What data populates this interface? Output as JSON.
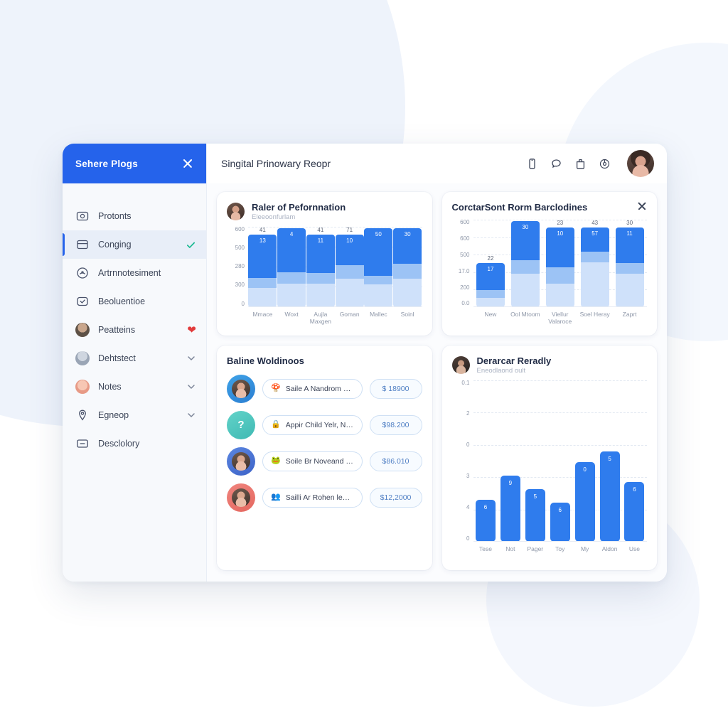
{
  "sidebar": {
    "title": "Sehere Plogs",
    "items": [
      {
        "label": "Protonts",
        "icon": "camera-icon",
        "trailing": "none"
      },
      {
        "label": "Conging",
        "icon": "window-icon",
        "trailing": "check"
      },
      {
        "label": "Artrnnotesiment",
        "icon": "compass-icon",
        "trailing": "none"
      },
      {
        "label": "Beoluentioe",
        "icon": "check-box-icon",
        "trailing": "none"
      },
      {
        "label": "Peatteins",
        "icon": "avatar-icon",
        "trailing": "heart"
      },
      {
        "label": "Dehtstect",
        "icon": "avatar-icon",
        "trailing": "chevron"
      },
      {
        "label": "Notes",
        "icon": "avatar-icon",
        "trailing": "chevron"
      },
      {
        "label": "Egneop",
        "icon": "pin-icon",
        "trailing": "chevron"
      },
      {
        "label": "Desclolory",
        "icon": "card-icon",
        "trailing": "none"
      }
    ]
  },
  "topbar": {
    "title": "Singital Prinowary Reopr",
    "icons": [
      "phone-icon",
      "chat-icon",
      "bag-icon",
      "globe-icon"
    ]
  },
  "cards": {
    "performance": {
      "title": "Raler of Pefornnation",
      "subtitle": "Eleeoonfurlam"
    },
    "breakdown": {
      "title": "CorctarSont Rorm Barclodines"
    },
    "list": {
      "title": "Baline Woldinoos"
    },
    "ready": {
      "title": "Derarcar Reradly",
      "subtitle": "Eneodlaond oult"
    }
  },
  "list_rows": [
    {
      "emoji": "🍄",
      "text": "Saile A Nandrom Clnins",
      "amount": "$ 18900",
      "avatar": "photo"
    },
    {
      "emoji": "🔒",
      "text": "Appir Child Yelr, Ne Sorery",
      "amount": "$98.200",
      "avatar": "question"
    },
    {
      "emoji": "🐸",
      "text": "Soile Br Noveand Chiilc",
      "amount": "$86.010",
      "avatar": "photo"
    },
    {
      "emoji": "👥",
      "text": "Sailli Ar Rohen lead Oldtive",
      "amount": "$12,2000",
      "avatar": "photo"
    }
  ],
  "chart_data": [
    {
      "id": "performance",
      "type": "bar",
      "stacked": true,
      "title": "Raler of Pefornnation",
      "subtitle": "Eleeoonfurlam",
      "xlabel": "",
      "ylabel": "",
      "grid": true,
      "ylim": [
        0,
        600
      ],
      "yticks": [
        "600",
        "500",
        "280",
        "300",
        "0"
      ],
      "categories": [
        "Mmace",
        "Woxt",
        "Aujla Maxgen",
        "Goman",
        "Mallec",
        "Soinl"
      ],
      "total_labels": [
        "41",
        "",
        "41",
        "71",
        "",
        ""
      ],
      "series": [
        {
          "name": "top",
          "color": "#2f7ced",
          "values": [
            125,
            150,
            185,
            130,
            245,
            200
          ],
          "labels": [
            "13",
            "4",
            "11",
            "10",
            "50",
            "30"
          ]
        },
        {
          "name": "middle",
          "color": "#9cc3f5",
          "values": [
            30,
            40,
            55,
            60,
            45,
            90
          ]
        },
        {
          "name": "bottom",
          "color": "#cfe1fa",
          "values": [
            55,
            80,
            115,
            125,
            120,
            165
          ]
        }
      ]
    },
    {
      "id": "breakdown",
      "type": "bar",
      "stacked": true,
      "title": "CorctarSont Rorm Barclodines",
      "grid": true,
      "ylim": [
        0,
        600
      ],
      "yticks": [
        "600",
        "600",
        "500",
        "17.0",
        "200",
        "0.0"
      ],
      "categories": [
        "New",
        "Ool Mtoom",
        "Viellur Valaroce",
        "Soel Heray",
        "Zaprt"
      ],
      "total_labels": [
        "22",
        "",
        "23",
        "43",
        "30"
      ],
      "series": [
        {
          "name": "top",
          "color": "#2f7ced",
          "values": [
            62,
            205,
            120,
            95,
            165
          ],
          "labels": [
            "17",
            "30",
            "10",
            "57",
            "11"
          ]
        },
        {
          "name": "middle",
          "color": "#9cc3f5",
          "values": [
            18,
            75,
            50,
            45,
            50
          ]
        },
        {
          "name": "bottom",
          "color": "#cfe1fa",
          "values": [
            20,
            180,
            70,
            185,
            160
          ]
        }
      ]
    },
    {
      "id": "ready",
      "type": "bar",
      "stacked": false,
      "title": "Derarcar Reradly",
      "subtitle": "Eneodlaond oult",
      "grid": true,
      "yticks": [
        "0.1",
        "2",
        "0",
        "3",
        "4",
        "0"
      ],
      "categories": [
        "Tese",
        "Not",
        "Pager",
        "Toy",
        "My",
        "Aldon",
        "Use"
      ],
      "values": [
        95,
        150,
        120,
        88,
        180,
        205,
        135
      ],
      "labels": [
        "6",
        "9",
        "5",
        "6",
        "0",
        "5",
        "6"
      ],
      "color": "#2f7ced"
    }
  ]
}
